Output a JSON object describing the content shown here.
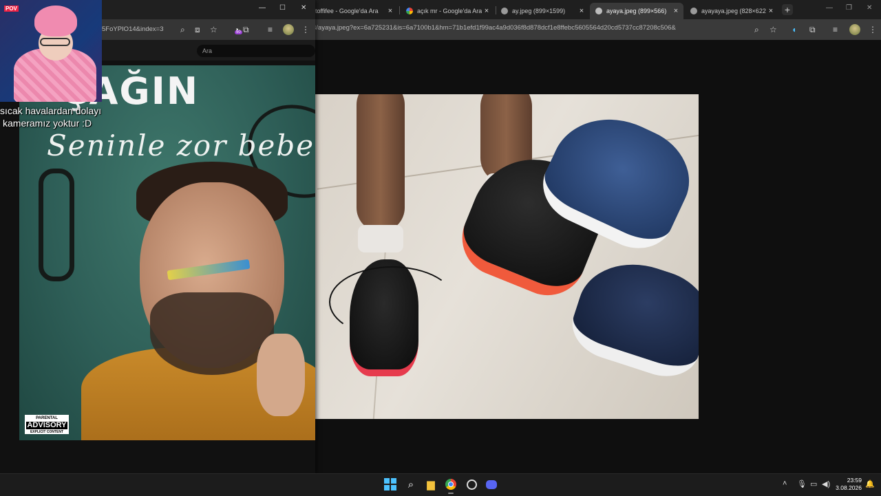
{
  "back_window": {
    "tabs": [
      {
        "label": "toffifee - Google'da Ara",
        "favicon": "google-icon"
      },
      {
        "label": "açık mr - Google'da Ara",
        "favicon": "google-icon"
      },
      {
        "label": "ay.jpeg (899×1599)",
        "favicon": "globe-icon"
      },
      {
        "label": "ayaya.jpeg (899×566)",
        "favicon": "globe-icon",
        "active": true
      },
      {
        "label": "ayayaya.jpeg (828×622)",
        "favicon": "globe-icon"
      }
    ],
    "new_tab": "+",
    "address": "8/ayaya.jpeg?ex=6a725231&is=6a7100b1&hm=71b1efd1f99ac4a9d036f8d878dcf1e8ffebc5605564d20cd5737cc87208c506&"
  },
  "front_window": {
    "address": "5FoYPIO14&index=3",
    "find_placeholder": "Ara",
    "extension_badge": "50",
    "album": {
      "artist": "ÇAĞIN",
      "song": "Seninle zor bebe",
      "advisory_line1": "PARENTAL",
      "advisory_line2": "ADVISORY",
      "advisory_line3": "EXPLICIT CONTENT"
    }
  },
  "webcam": {
    "tag": "POV",
    "caption_line1": "sıcak havalardan dolayı",
    "caption_line2": "kameramız yoktur :D"
  },
  "taskbar": {
    "time": "23:59",
    "date": "3.08.2026",
    "apps": [
      "windows-start-icon",
      "search-icon",
      "file-explorer-icon",
      "chrome-icon",
      "obs-icon",
      "discord-icon"
    ]
  },
  "colors": {
    "accent": "#4cc2ff",
    "chrome_dark": "#202020"
  }
}
